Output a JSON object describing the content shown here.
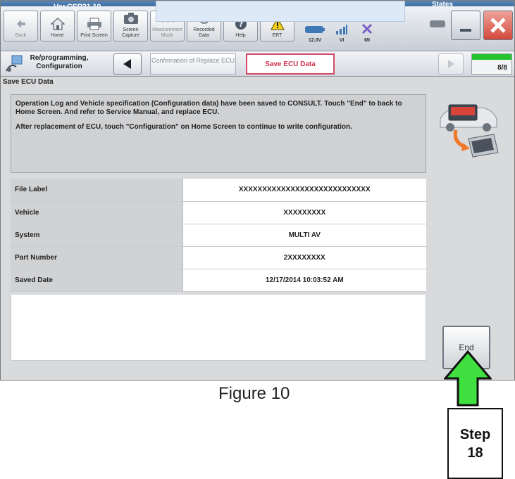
{
  "app": {
    "version": "Ver.CSP21.10",
    "states_label": "States"
  },
  "toolbar": {
    "buttons": [
      {
        "label": "Back",
        "icon": "back-arrow-icon",
        "enabled": false
      },
      {
        "label": "Home",
        "icon": "home-icon",
        "enabled": true
      },
      {
        "label": "Print Screen",
        "icon": "printer-icon",
        "enabled": true
      },
      {
        "label": "Screen Capture",
        "icon": "camera-icon",
        "enabled": true
      },
      {
        "label": "Measurement Mode",
        "icon": "gauge-icon",
        "enabled": false
      },
      {
        "label": "Recorded Data",
        "icon": "recorder-icon",
        "enabled": true
      },
      {
        "label": "Help",
        "icon": "help-icon",
        "enabled": true
      },
      {
        "label": "ERT",
        "icon": "warning-icon",
        "enabled": true
      }
    ],
    "status": [
      {
        "label": "12.0V",
        "icon": "battery-icon"
      },
      {
        "label": "VI",
        "icon": "signal-icon"
      },
      {
        "label": "MI",
        "icon": "x-mark-icon"
      }
    ]
  },
  "breadcrumb": {
    "step1": "Re/programming, Configuration",
    "step2": "Confirmation of Replace ECU",
    "current": "Save ECU Data",
    "progress": "8/8",
    "progress_fraction": 1.0
  },
  "section_title": "Save ECU Data",
  "messages": [
    "Operation Log and Vehicle specification (Configuration data) have been saved to CONSULT. Touch \"End\" to back to Home Screen. And refer to Service Manual, and replace ECU.",
    "After replacement of ECU, touch \"Configuration\" on Home Screen to continue to write configuration."
  ],
  "table": [
    {
      "label": "File Label",
      "value": "XXXXXXXXXXXXXXXXXXXXXXXXXXXX"
    },
    {
      "label": "Vehicle",
      "value": "XXXXXXXXX"
    },
    {
      "label": "System",
      "value": "MULTI AV"
    },
    {
      "label": "Part Number",
      "value": "2XXXXXXXX"
    },
    {
      "label": "Saved Date",
      "value": "12/17/2014 10:03:52 AM"
    }
  ],
  "end_button": "End",
  "figure_caption": "Figure 10",
  "step_callout": {
    "line1": "Step",
    "line2": "18"
  },
  "colors": {
    "accent": "#d54b67",
    "progress": "#27c22f",
    "arrow": "#3fe03f"
  }
}
